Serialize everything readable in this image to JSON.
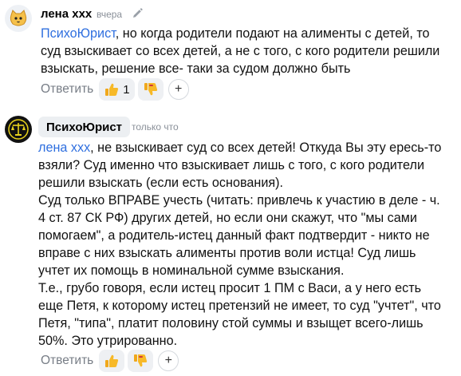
{
  "comments": [
    {
      "author": "лена ххх",
      "time": "вчера",
      "mention": "ПсихоЮрист",
      "text": ", но когда родители подают на алименты с детей, то суд взыскивает со всех детей, а не с того, с кого родители решили взыскать, решение все- таки за судом должно быть",
      "reply_label": "Ответить",
      "like_count": "1",
      "icons": {
        "like": "thumbs-up-icon",
        "dislike": "thumbs-down-icon",
        "add": "plus-icon",
        "edit": "pencil-icon",
        "avatar": "cat-avatar"
      }
    },
    {
      "author": "ПсихоЮрист",
      "time": "только что",
      "mention": "лена ххх",
      "text": ", не взыскивает суд со всех детей! Откуда Вы эту ересь-то взяли? Суд именно что взыскивает лишь с того, с кого родители решили взыскать (если есть основания).\nСуд только ВПРАВЕ учесть (читать: привлечь к участию в деле - ч. 4 ст. 87 СК РФ) других детей, но если они скажут, что \"мы сами помогаем\", а родитель-истец данный факт подтвердит - никто не вправе с них взыскать алименты против воли истца! Суд лишь учтет их помощь в номинальной сумме взыскания.\nТ.е., грубо говоря, если истец просит 1 ПМ с Васи, а у него есть еще Петя, к которому истец претензий не имеет, то суд \"учтет\", что Петя, \"типа\", платит половину стой суммы и взыщет всего-лишь 50%. Это утрированно.",
      "reply_label": "Ответить",
      "icons": {
        "like": "thumbs-up-icon",
        "dislike": "thumbs-down-icon",
        "add": "plus-icon",
        "avatar": "scales-avatar"
      }
    }
  ]
}
